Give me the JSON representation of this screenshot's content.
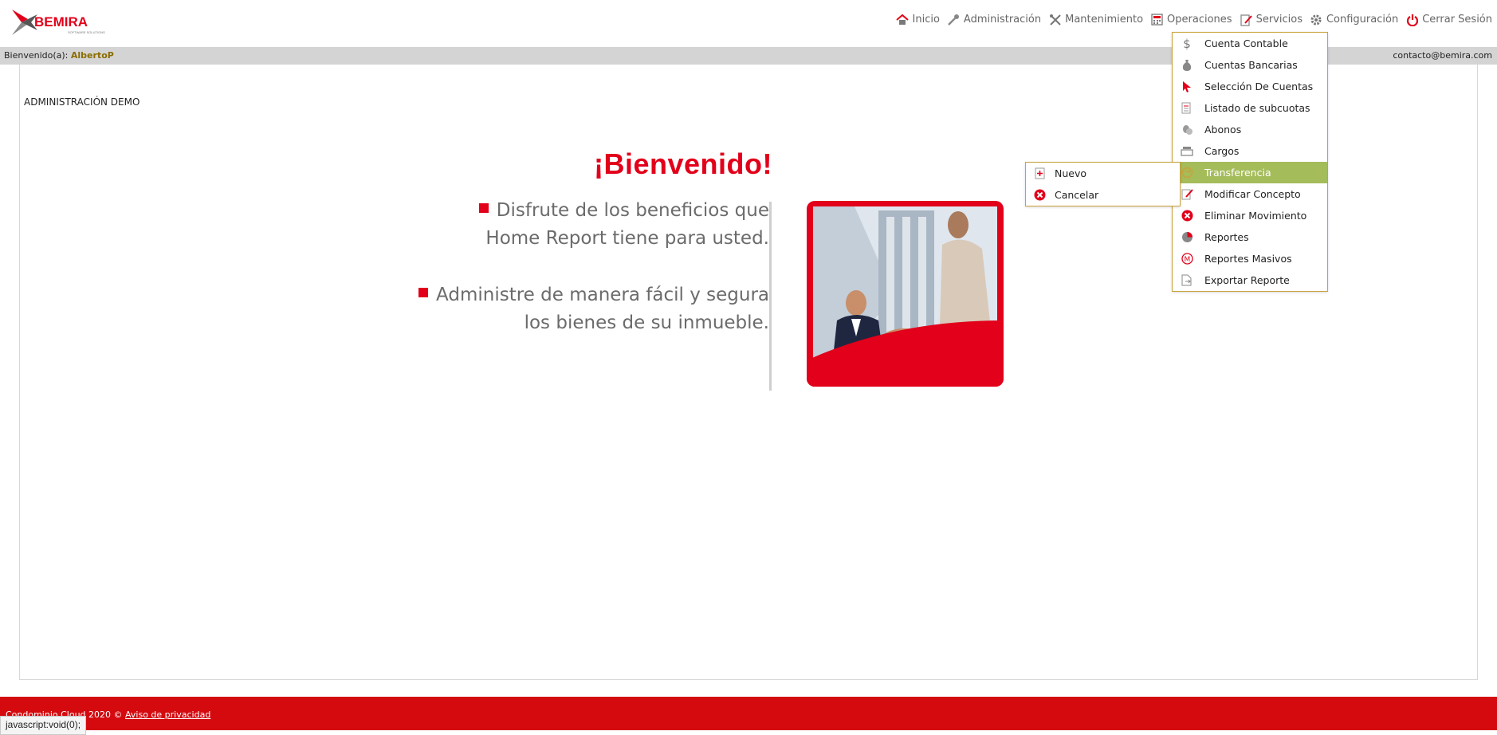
{
  "brand": {
    "logo_text": "BEMIRA",
    "logo_sub": "SOFTWARE SOLUTIONS",
    "accent": "#e2001a"
  },
  "nav": [
    {
      "label": "Inicio",
      "icon": "home-icon"
    },
    {
      "label": "Administración",
      "icon": "key-icon"
    },
    {
      "label": "Mantenimiento",
      "icon": "tools-icon"
    },
    {
      "label": "Operaciones",
      "icon": "calculator-icon"
    },
    {
      "label": "Servicios",
      "icon": "edit-document-icon"
    },
    {
      "label": "Configuración",
      "icon": "gear-icon"
    },
    {
      "label": "Cerrar Sesión",
      "icon": "power-icon"
    }
  ],
  "welcome_bar": {
    "greeting": "Bienvenido(a):",
    "user": "AlbertoP",
    "email": "contacto@bemira.com"
  },
  "org_name": "ADMINISTRACIÓN DEMO",
  "hero": {
    "title": "¡Bienvenido!",
    "bullet1_line1": "Disfrute de los beneficios que",
    "bullet1_line2": "Home Report tiene para usted.",
    "bullet2_line1": "Administre de manera fácil y segura",
    "bullet2_line2": "los bienes de su inmueble."
  },
  "operaciones_menu": [
    {
      "label": "Cuenta Contable",
      "icon": "dollar-icon"
    },
    {
      "label": "Cuentas Bancarias",
      "icon": "money-bag-icon"
    },
    {
      "label": "Selección De Cuentas",
      "icon": "cursor-icon"
    },
    {
      "label": "Listado de subcuotas",
      "icon": "list-document-icon"
    },
    {
      "label": "Abonos",
      "icon": "coins-icon"
    },
    {
      "label": "Cargos",
      "icon": "cash-register-icon"
    },
    {
      "label": "Transferencia",
      "icon": "transfer-icon",
      "active": true
    },
    {
      "label": "Modificar Concepto",
      "icon": "edit-icon"
    },
    {
      "label": "Eliminar Movimiento",
      "icon": "delete-circle-icon"
    },
    {
      "label": "Reportes",
      "icon": "pie-chart-icon"
    },
    {
      "label": "Reportes Masivos",
      "icon": "m-circle-icon"
    },
    {
      "label": "Exportar Reporte",
      "icon": "export-icon"
    }
  ],
  "transferencia_submenu": [
    {
      "label": "Nuevo",
      "icon": "new-document-icon"
    },
    {
      "label": "Cancelar",
      "icon": "cancel-circle-icon"
    }
  ],
  "footer": {
    "copyright": "Condominio Cloud 2020 ©",
    "privacy_link": "Aviso de privacidad"
  },
  "status_bar": "javascript:void(0);"
}
